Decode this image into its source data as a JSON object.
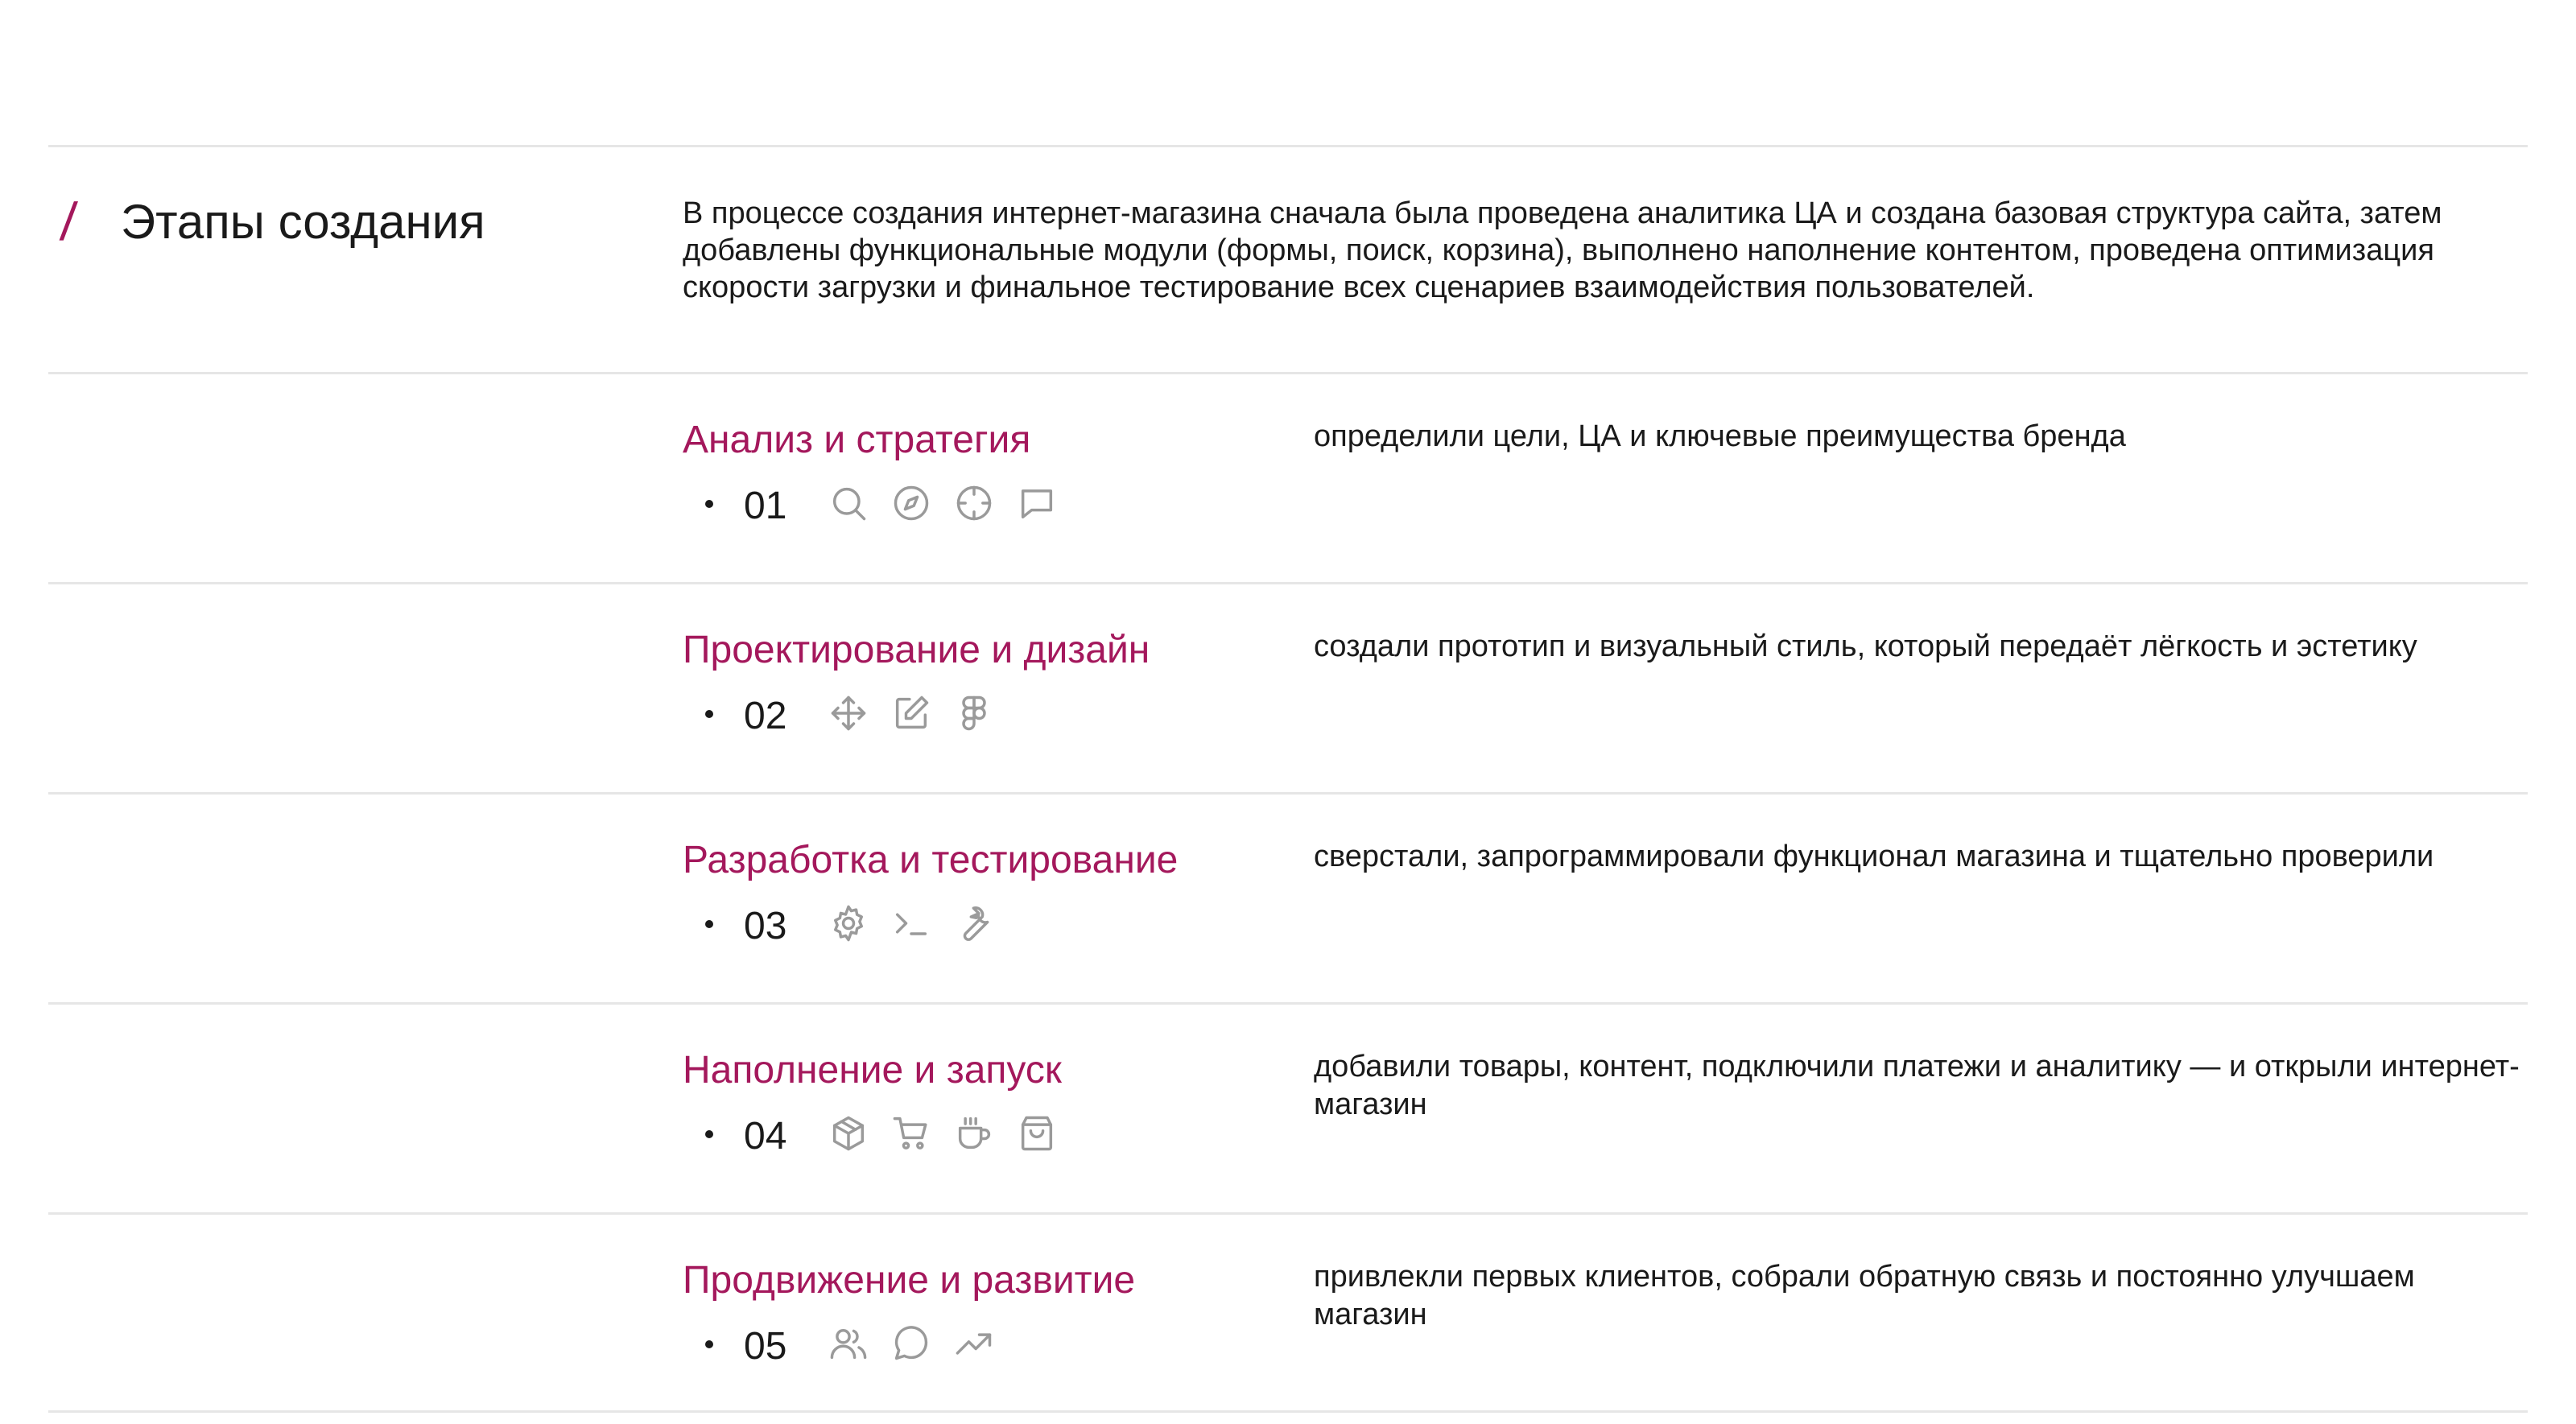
{
  "intro": {
    "slash": "/",
    "title": "Этапы создания",
    "text": "В процессе создания интернет-магазина сначала была проведена аналитика ЦА и создана базовая структура сайта, затем добавлены функциональные модули (формы, поиск, корзина), выполнено наполнение контентом, проведена оптимизация скорости загрузки и финальное тестирование всех сценариев взаимодействия пользователей."
  },
  "accent_color": "#a4185c",
  "stages": [
    {
      "title": "Анализ и стратегия",
      "number": "01",
      "description": "определили цели, ЦА и ключевые преимущества бренда",
      "icons": [
        "search-icon",
        "compass-icon",
        "target-icon",
        "chat-bubble-icon"
      ]
    },
    {
      "title": "Проектирование и дизайн",
      "number": "02",
      "description": "создали прототип и визуальный стиль, который передаёт лёгкость и эстетику",
      "icons": [
        "move-icon",
        "edit-icon",
        "figma-icon"
      ]
    },
    {
      "title": "Разработка и тестирование",
      "number": "03",
      "description": "сверстали, запрограммировали функционал магазина и тщательно проверили",
      "icons": [
        "gear-icon",
        "terminal-icon",
        "wrench-icon"
      ]
    },
    {
      "title": "Наполнение и запуск",
      "number": "04",
      "description": "добавили товары, контент, подключили платежи и аналитику — и открыли интернет-магазин",
      "icons": [
        "box-icon",
        "cart-icon",
        "coffee-icon",
        "shopping-bag-icon"
      ]
    },
    {
      "title": "Продвижение и развитие",
      "number": "05",
      "description": "привлекли первых клиентов, собрали обратную связь и постоянно улучшаем магазин",
      "icons": [
        "users-icon",
        "message-circle-icon",
        "trending-up-icon"
      ]
    }
  ]
}
